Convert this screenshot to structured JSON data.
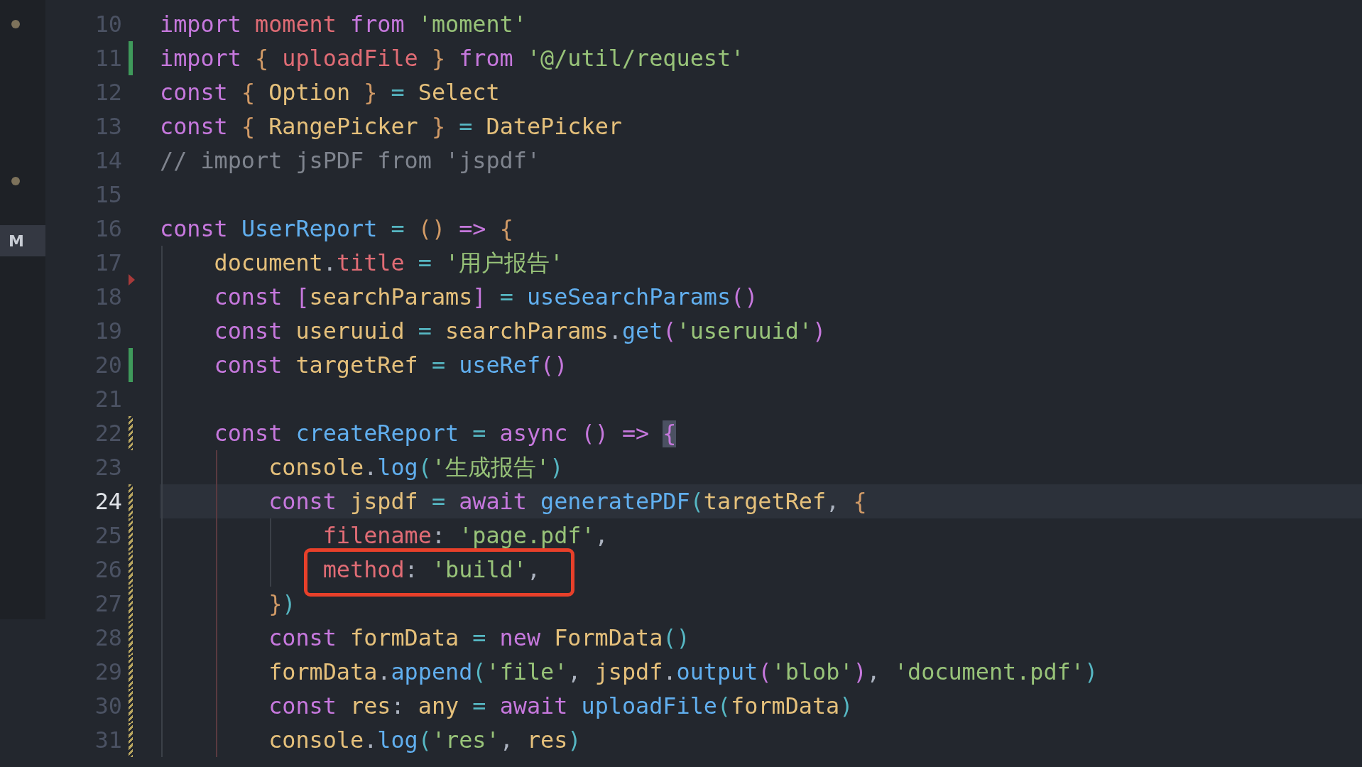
{
  "sidebar": {
    "items": [
      {
        "kind": "dot"
      },
      {
        "kind": "dot"
      },
      {
        "kind": "badge",
        "text": "M"
      }
    ]
  },
  "lines": [
    {
      "number": "10",
      "current": false,
      "kind": "unchanged",
      "tokens": [
        {
          "kind": "kw",
          "text": "import "
        },
        {
          "kind": "var",
          "text": "moment "
        },
        {
          "kind": "kw",
          "text": "from "
        },
        {
          "kind": "str",
          "text": "'moment'"
        }
      ]
    },
    {
      "number": "11",
      "current": false,
      "kind": "added",
      "tokens": [
        {
          "kind": "kw",
          "text": "import "
        },
        {
          "kind": "b1",
          "text": "{ "
        },
        {
          "kind": "var",
          "text": "uploadFile "
        },
        {
          "kind": "b1",
          "text": "} "
        },
        {
          "kind": "kw",
          "text": "from "
        },
        {
          "kind": "str",
          "text": "'@/util/request'"
        }
      ]
    },
    {
      "number": "12",
      "current": false,
      "kind": "unchanged",
      "tokens": [
        {
          "kind": "kw",
          "text": "const "
        },
        {
          "kind": "b1",
          "text": "{ "
        },
        {
          "kind": "cls",
          "text": "Option "
        },
        {
          "kind": "b1",
          "text": "} "
        },
        {
          "kind": "op",
          "text": "= "
        },
        {
          "kind": "cls",
          "text": "Select"
        }
      ]
    },
    {
      "number": "13",
      "current": false,
      "kind": "unchanged",
      "tokens": [
        {
          "kind": "kw",
          "text": "const "
        },
        {
          "kind": "b1",
          "text": "{ "
        },
        {
          "kind": "cls",
          "text": "RangePicker "
        },
        {
          "kind": "b1",
          "text": "} "
        },
        {
          "kind": "op",
          "text": "= "
        },
        {
          "kind": "cls",
          "text": "DatePicker"
        }
      ]
    },
    {
      "number": "14",
      "current": false,
      "kind": "unchanged",
      "tokens": [
        {
          "kind": "cmt",
          "text": "// import jsPDF from 'jspdf'"
        }
      ]
    },
    {
      "number": "15",
      "current": false,
      "kind": "unchanged"
    },
    {
      "number": "16",
      "current": false,
      "kind": "unchanged",
      "tokens": [
        {
          "kind": "kw",
          "text": "const "
        },
        {
          "kind": "fn",
          "text": "UserReport "
        },
        {
          "kind": "op",
          "text": "= "
        },
        {
          "kind": "b1",
          "text": "() "
        },
        {
          "kind": "kw",
          "text": "=> "
        },
        {
          "kind": "b1",
          "text": "{"
        }
      ]
    },
    {
      "number": "17",
      "current": false,
      "kind": "deleted",
      "tokens": [
        {
          "kind": "cls",
          "text": "    document"
        },
        {
          "kind": "pl",
          "text": "."
        },
        {
          "kind": "var",
          "text": "title "
        },
        {
          "kind": "op",
          "text": "= "
        },
        {
          "kind": "str",
          "text": "'用户报告'"
        }
      ]
    },
    {
      "number": "18",
      "current": false,
      "kind": "unchanged",
      "tokens": [
        {
          "kind": "kw",
          "text": "    const "
        },
        {
          "kind": "b2",
          "text": "["
        },
        {
          "kind": "cls",
          "text": "searchParams"
        },
        {
          "kind": "b2",
          "text": "] "
        },
        {
          "kind": "op",
          "text": "= "
        },
        {
          "kind": "fn",
          "text": "useSearchParams"
        },
        {
          "kind": "b2",
          "text": "()"
        }
      ]
    },
    {
      "number": "19",
      "current": false,
      "kind": "unchanged",
      "tokens": [
        {
          "kind": "kw",
          "text": "    const "
        },
        {
          "kind": "cls",
          "text": "useruuid "
        },
        {
          "kind": "op",
          "text": "= "
        },
        {
          "kind": "cls",
          "text": "searchParams"
        },
        {
          "kind": "pl",
          "text": "."
        },
        {
          "kind": "fn",
          "text": "get"
        },
        {
          "kind": "b2",
          "text": "("
        },
        {
          "kind": "str",
          "text": "'useruuid'"
        },
        {
          "kind": "b2",
          "text": ")"
        }
      ]
    },
    {
      "number": "20",
      "current": false,
      "kind": "added",
      "tokens": [
        {
          "kind": "kw",
          "text": "    const "
        },
        {
          "kind": "cls",
          "text": "targetRef "
        },
        {
          "kind": "op",
          "text": "= "
        },
        {
          "kind": "fn",
          "text": "useRef"
        },
        {
          "kind": "b2",
          "text": "()"
        }
      ]
    },
    {
      "number": "21",
      "current": false,
      "kind": "unchanged"
    },
    {
      "number": "22",
      "current": false,
      "kind": "modified",
      "tokens": [
        {
          "kind": "kw",
          "text": "    const "
        },
        {
          "kind": "fn",
          "text": "createReport "
        },
        {
          "kind": "op",
          "text": "= "
        },
        {
          "kind": "kw",
          "text": "async "
        },
        {
          "kind": "b2",
          "text": "() "
        },
        {
          "kind": "kw",
          "text": "=> "
        },
        {
          "kind": "b2",
          "text": "{",
          "matched": true
        }
      ]
    },
    {
      "number": "23",
      "current": false,
      "kind": "unchanged",
      "tokens": [
        {
          "kind": "cls",
          "text": "        console"
        },
        {
          "kind": "pl",
          "text": "."
        },
        {
          "kind": "fn",
          "text": "log"
        },
        {
          "kind": "b3",
          "text": "("
        },
        {
          "kind": "str",
          "text": "'生成报告'"
        },
        {
          "kind": "b3",
          "text": ")"
        }
      ]
    },
    {
      "number": "24",
      "current": true,
      "kind": "modified",
      "tokens": [
        {
          "kind": "kw",
          "text": "        const "
        },
        {
          "kind": "cls",
          "text": "jspdf "
        },
        {
          "kind": "op",
          "text": "= "
        },
        {
          "kind": "kw",
          "text": "await "
        },
        {
          "kind": "fn",
          "text": "generatePDF"
        },
        {
          "kind": "b3",
          "text": "("
        },
        {
          "kind": "cls",
          "text": "targetRef"
        },
        {
          "kind": "pl",
          "text": ", "
        },
        {
          "kind": "b1",
          "text": "{"
        }
      ]
    },
    {
      "number": "25",
      "current": false,
      "kind": "modified",
      "tokens": [
        {
          "kind": "var",
          "text": "            filename"
        },
        {
          "kind": "pl",
          "text": ": "
        },
        {
          "kind": "str",
          "text": "'page.pdf'"
        },
        {
          "kind": "pl",
          "text": ","
        }
      ]
    },
    {
      "number": "26",
      "current": false,
      "kind": "modified",
      "boxed": true,
      "tokens": [
        {
          "kind": "var",
          "text": "            method"
        },
        {
          "kind": "pl",
          "text": ": "
        },
        {
          "kind": "str",
          "text": "'build'"
        },
        {
          "kind": "pl",
          "text": ","
        }
      ]
    },
    {
      "number": "27",
      "current": false,
      "kind": "modified",
      "tokens": [
        {
          "kind": "b1",
          "text": "        }"
        },
        {
          "kind": "b3",
          "text": ")"
        }
      ]
    },
    {
      "number": "28",
      "current": false,
      "kind": "modified",
      "tokens": [
        {
          "kind": "kw",
          "text": "        const "
        },
        {
          "kind": "cls",
          "text": "formData "
        },
        {
          "kind": "op",
          "text": "= "
        },
        {
          "kind": "kw",
          "text": "new "
        },
        {
          "kind": "cls",
          "text": "FormData"
        },
        {
          "kind": "b3",
          "text": "()"
        }
      ]
    },
    {
      "number": "29",
      "current": false,
      "kind": "modified",
      "tokens": [
        {
          "kind": "cls",
          "text": "        formData"
        },
        {
          "kind": "pl",
          "text": "."
        },
        {
          "kind": "fn",
          "text": "append"
        },
        {
          "kind": "b3",
          "text": "("
        },
        {
          "kind": "str",
          "text": "'file'"
        },
        {
          "kind": "pl",
          "text": ", "
        },
        {
          "kind": "cls",
          "text": "jspdf"
        },
        {
          "kind": "pl",
          "text": "."
        },
        {
          "kind": "fn",
          "text": "output"
        },
        {
          "kind": "b2",
          "text": "("
        },
        {
          "kind": "str",
          "text": "'blob'"
        },
        {
          "kind": "b2",
          "text": ")"
        },
        {
          "kind": "pl",
          "text": ", "
        },
        {
          "kind": "str",
          "text": "'document.pdf'"
        },
        {
          "kind": "b3",
          "text": ")"
        }
      ]
    },
    {
      "number": "30",
      "current": false,
      "kind": "modified",
      "tokens": [
        {
          "kind": "kw",
          "text": "        const "
        },
        {
          "kind": "cls",
          "text": "res"
        },
        {
          "kind": "pl",
          "text": ": "
        },
        {
          "kind": "cls",
          "text": "any "
        },
        {
          "kind": "op",
          "text": "= "
        },
        {
          "kind": "kw",
          "text": "await "
        },
        {
          "kind": "fn",
          "text": "uploadFile"
        },
        {
          "kind": "b3",
          "text": "("
        },
        {
          "kind": "cls",
          "text": "formData"
        },
        {
          "kind": "b3",
          "text": ")"
        }
      ]
    },
    {
      "number": "31",
      "current": false,
      "kind": "modified",
      "tokens": [
        {
          "kind": "cls",
          "text": "        console"
        },
        {
          "kind": "pl",
          "text": "."
        },
        {
          "kind": "fn",
          "text": "log"
        },
        {
          "kind": "b3",
          "text": "("
        },
        {
          "kind": "str",
          "text": "'res'"
        },
        {
          "kind": "pl",
          "text": ", "
        },
        {
          "kind": "cls",
          "text": "res"
        },
        {
          "kind": "b3",
          "text": ")"
        }
      ]
    }
  ]
}
